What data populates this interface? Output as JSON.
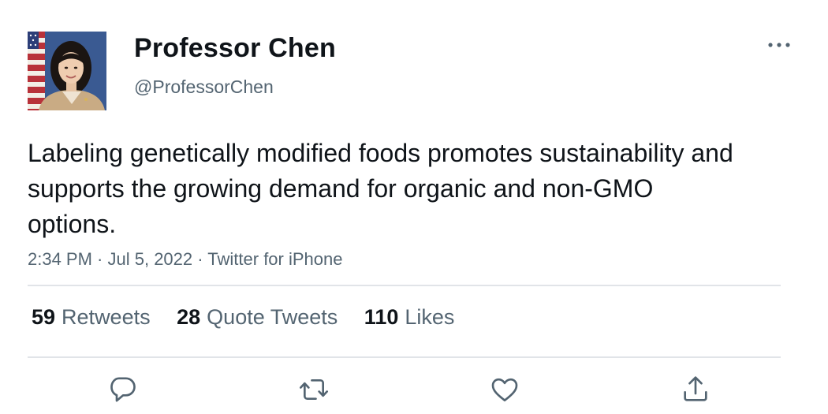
{
  "author": {
    "display_name": "Professor Chen",
    "handle": "@ProfessorChen",
    "avatar_icon": "profile-photo"
  },
  "tweet": {
    "text": "Labeling genetically modified foods promotes sustainability and supports the growing demand for organic and non-GMO options.",
    "time": "2:34 PM",
    "date": "Jul 5, 2022",
    "source": "Twitter for iPhone",
    "separator": " · "
  },
  "stats": {
    "retweets": {
      "count": "59",
      "label": "Retweets"
    },
    "quote_tweets": {
      "count": "28",
      "label": "Quote Tweets"
    },
    "likes": {
      "count": "110",
      "label": "Likes"
    }
  },
  "actions": [
    {
      "name": "reply",
      "icon": "reply-icon"
    },
    {
      "name": "retweet",
      "icon": "retweet-icon"
    },
    {
      "name": "like",
      "icon": "heart-icon"
    },
    {
      "name": "share",
      "icon": "share-icon"
    }
  ],
  "colors": {
    "text_primary": "#0f1419",
    "text_secondary": "#536471",
    "divider": "#e1e4e8",
    "icon": "#536471"
  }
}
